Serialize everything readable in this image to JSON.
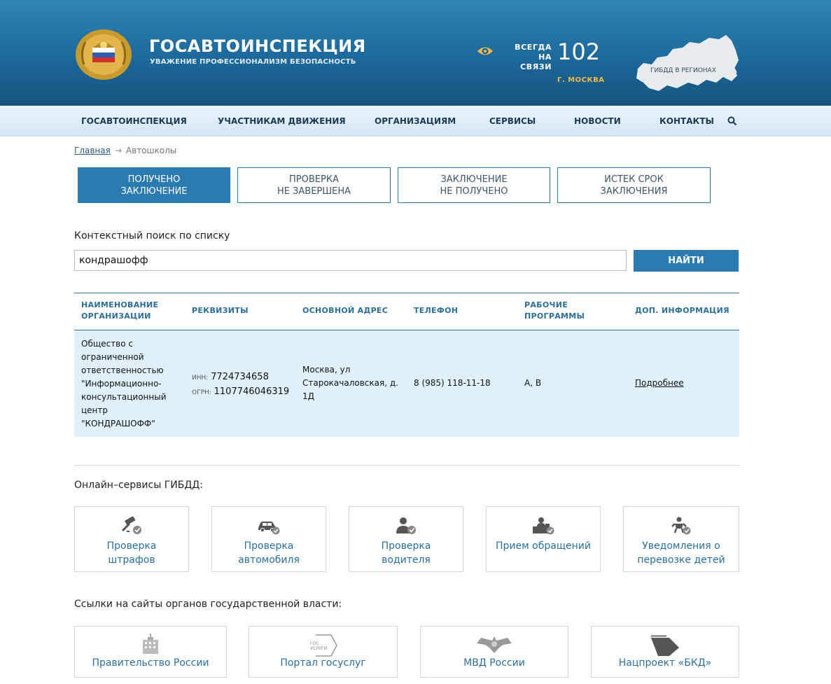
{
  "header": {
    "brand_title": "ГОСАВТОИНСПЕКЦИЯ",
    "brand_subtitle": "УВАЖЕНИЕ ПРОФЕССИОНАЛИЗМ БЕЗОПАСНОСТЬ",
    "always_line1": "ВСЕГДА",
    "always_line2": "НА СВЯЗИ",
    "hotline": "102",
    "city": "Г. МОСКВА",
    "regions_label": "ГИБДД В РЕГИОНАХ"
  },
  "nav": {
    "items": [
      "ГОСАВТОИНСПЕКЦИЯ",
      "УЧАСТНИКАМ ДВИЖЕНИЯ",
      "ОРГАНИЗАЦИЯМ",
      "СЕРВИСЫ",
      "НОВОСТИ",
      "КОНТАКТЫ"
    ]
  },
  "breadcrumb": {
    "home": "Главная",
    "arrow": "→",
    "current": "Автошколы"
  },
  "tabs": [
    {
      "line1": "Получено",
      "line2": "заключение",
      "active": true
    },
    {
      "line1": "Проверка",
      "line2": "не завершена",
      "active": false
    },
    {
      "line1": "Заключение",
      "line2": "не получено",
      "active": false
    },
    {
      "line1": "Истек срок",
      "line2": "заключения",
      "active": false
    }
  ],
  "search": {
    "label": "Контекстный поиск по списку",
    "value": "кондрашофф",
    "button": "НАЙТИ"
  },
  "table": {
    "headers": [
      {
        "line1": "НАИМЕНОВАНИЕ",
        "line2": "ОРГАНИЗАЦИИ"
      },
      {
        "line1": "РЕКВИЗИТЫ",
        "line2": ""
      },
      {
        "line1": "ОСНОВНОЙ АДРЕС",
        "line2": ""
      },
      {
        "line1": "ТЕЛЕФОН",
        "line2": ""
      },
      {
        "line1": "РАБОЧИЕ",
        "line2": "ПРОГРАММЫ"
      },
      {
        "line1": "ДОП. ИНФОРМАЦИЯ",
        "line2": ""
      }
    ],
    "row": {
      "name_lines": [
        "Общество с",
        "ограниченной",
        "ответственностью",
        "\"Информационно-",
        "консультационный",
        "центр",
        "\"КОНДРАШОФФ\""
      ],
      "inn_label": "ИНН:",
      "inn": "7724734658",
      "ogrn_label": "ОГРН:",
      "ogrn": "1107746046319",
      "address_lines": [
        "Москва, ул",
        "Старокачаловская, д.",
        "1Д"
      ],
      "phone": "8 (985) 118-11-18",
      "programs": "А, В",
      "more": "Подробнее"
    }
  },
  "services": {
    "title": "Онлайн–сервисы ГИБДД:",
    "cards": [
      {
        "line1": "Проверка",
        "line2": "штрафов",
        "icon": "gavel-icon"
      },
      {
        "line1": "Проверка",
        "line2": "автомобиля",
        "icon": "car-icon"
      },
      {
        "line1": "Проверка",
        "line2": "водителя",
        "icon": "driver-icon"
      },
      {
        "line1": "Прием обращений",
        "line2": "",
        "icon": "desk-icon"
      },
      {
        "line1": "Уведомления о",
        "line2": "перевозке детей",
        "icon": "child-icon"
      }
    ]
  },
  "gov_links": {
    "title": "Ссылки на сайты органов государственной власти:",
    "items": [
      {
        "label": "Правительство России",
        "icon": "government-building-icon"
      },
      {
        "label": "Портал госуслуг",
        "icon": "gosuslugi-logo",
        "logo_text": "ГОС УСЛУГИ"
      },
      {
        "label": "МВД России",
        "icon": "mvd-eagle-icon"
      },
      {
        "label": "Нацпроект «БКД»",
        "icon": "bkd-logo"
      }
    ]
  },
  "colors": {
    "primary": "#2c7bb0",
    "header_dark": "#15557f",
    "accent": "#f2b94a",
    "row_bg": "#dff0fa"
  }
}
